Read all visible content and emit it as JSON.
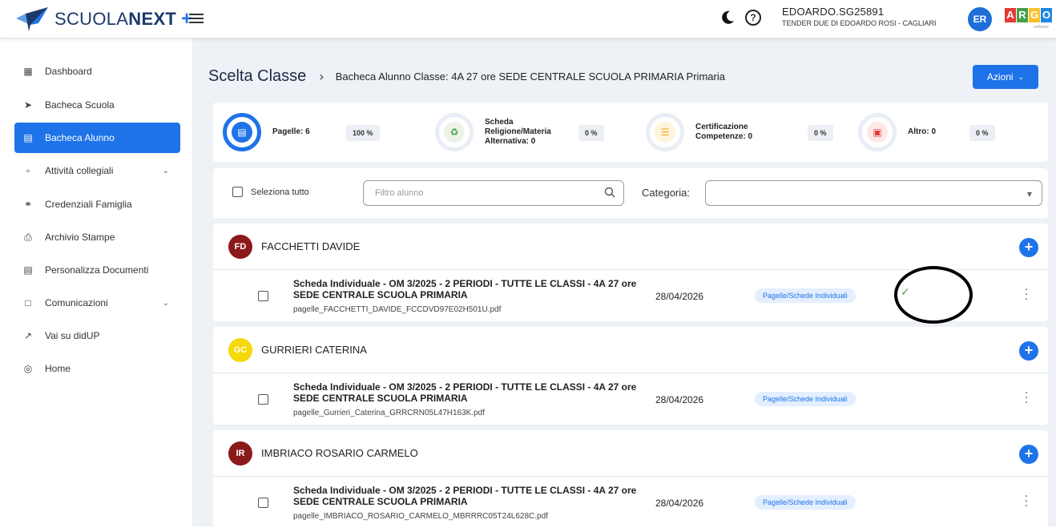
{
  "header": {
    "logo_text_light": "SCUOLA",
    "logo_text_bold": "NEXT",
    "logo_plus": "+",
    "user_name": "EDOARDO.SG25891",
    "user_school": "TENDER DUE DI EDOARDO ROSI - CAGLIARI",
    "user_initials": "ER",
    "brand_letters": [
      "A",
      "R",
      "G",
      "O"
    ],
    "brand_colors": [
      "#e53935",
      "#43a047",
      "#fbc02d",
      "#1e88e5"
    ],
    "brand_sub": "software"
  },
  "sidebar": {
    "items": [
      {
        "label": "Dashboard",
        "icon": "grid-icon"
      },
      {
        "label": "Bacheca Scuola",
        "icon": "pin-icon"
      },
      {
        "label": "Bacheca Alunno",
        "icon": "calendar-icon",
        "active": true
      },
      {
        "label": "Attività collegiali",
        "icon": "clipboard-icon",
        "expandable": true
      },
      {
        "label": "Credenziali Famiglia",
        "icon": "key-icon"
      },
      {
        "label": "Archivio Stampe",
        "icon": "printer-icon"
      },
      {
        "label": "Personalizza Documenti",
        "icon": "document-icon"
      },
      {
        "label": "Comunicazioni",
        "icon": "chat-icon",
        "expandable": true
      },
      {
        "label": "Vai su didUP",
        "icon": "external-link-icon"
      },
      {
        "label": "Home",
        "icon": "globe-icon"
      }
    ]
  },
  "main": {
    "title": "Scelta Classe",
    "breadcrumb_sep": "›",
    "breadcrumb": "Bacheca Alunno Classe: 4A 27 ore SEDE CENTRALE SCUOLA PRIMARIA Primaria",
    "actions_label": "Azioni",
    "stats": [
      {
        "label": "Pagelle: 6",
        "pct": "100 %",
        "color": "#1e73e8"
      },
      {
        "label": "Scheda Religione/Materia Alternativa: 0",
        "pct": "0 %",
        "color": "#43a047"
      },
      {
        "label": "Certificazione Competenze: 0",
        "pct": "0 %",
        "color": "#f9a825"
      },
      {
        "label": "Altro: 0",
        "pct": "0 %",
        "color": "#e53935"
      }
    ],
    "filter": {
      "select_all": "Seleziona tutto",
      "search_placeholder": "Filtro alunno",
      "category_label": "Categoria:"
    },
    "students": [
      {
        "initials": "FD",
        "name": "FACCHETTI DAVIDE",
        "avatar_color": "#8b1a1a",
        "doc": {
          "title": "Scheda Individuale - OM 3/2025 - 2 PERIODI - TUTTE LE CLASSI - 4A 27 ore SEDE CENTRALE SCUOLA PRIMARIA",
          "file": "pagelle_FACCHETTI_DAVIDE_FCCDVD97E02H501U.pdf",
          "date": "28/04/2026",
          "badge": "Pagelle/Schede Individuali",
          "checked": "✓"
        }
      },
      {
        "initials": "GC",
        "name": "GURRIERI CATERINA",
        "avatar_color": "#f5d90a",
        "doc": {
          "title": "Scheda Individuale - OM 3/2025 - 2 PERIODI - TUTTE LE CLASSI - 4A 27 ore SEDE CENTRALE SCUOLA PRIMARIA",
          "file": "pagelle_Gurrieri_Caterina_GRRCRN05L47H163K.pdf",
          "date": "28/04/2026",
          "badge": "Pagelle/Schede Individuali",
          "checked": ""
        }
      },
      {
        "initials": "IR",
        "name": "IMBRIACO ROSARIO CARMELO",
        "avatar_color": "#8b1a1a",
        "doc": {
          "title": "Scheda Individuale - OM 3/2025 - 2 PERIODI - TUTTE LE CLASSI - 4A 27 ore SEDE CENTRALE SCUOLA PRIMARIA",
          "file": "pagelle_IMBRIACO_ROSARIO_CARMELO_MBRRRC05T24L628C.pdf",
          "date": "28/04/2026",
          "badge": "Pagelle/Schede Individuali",
          "checked": ""
        }
      }
    ]
  }
}
